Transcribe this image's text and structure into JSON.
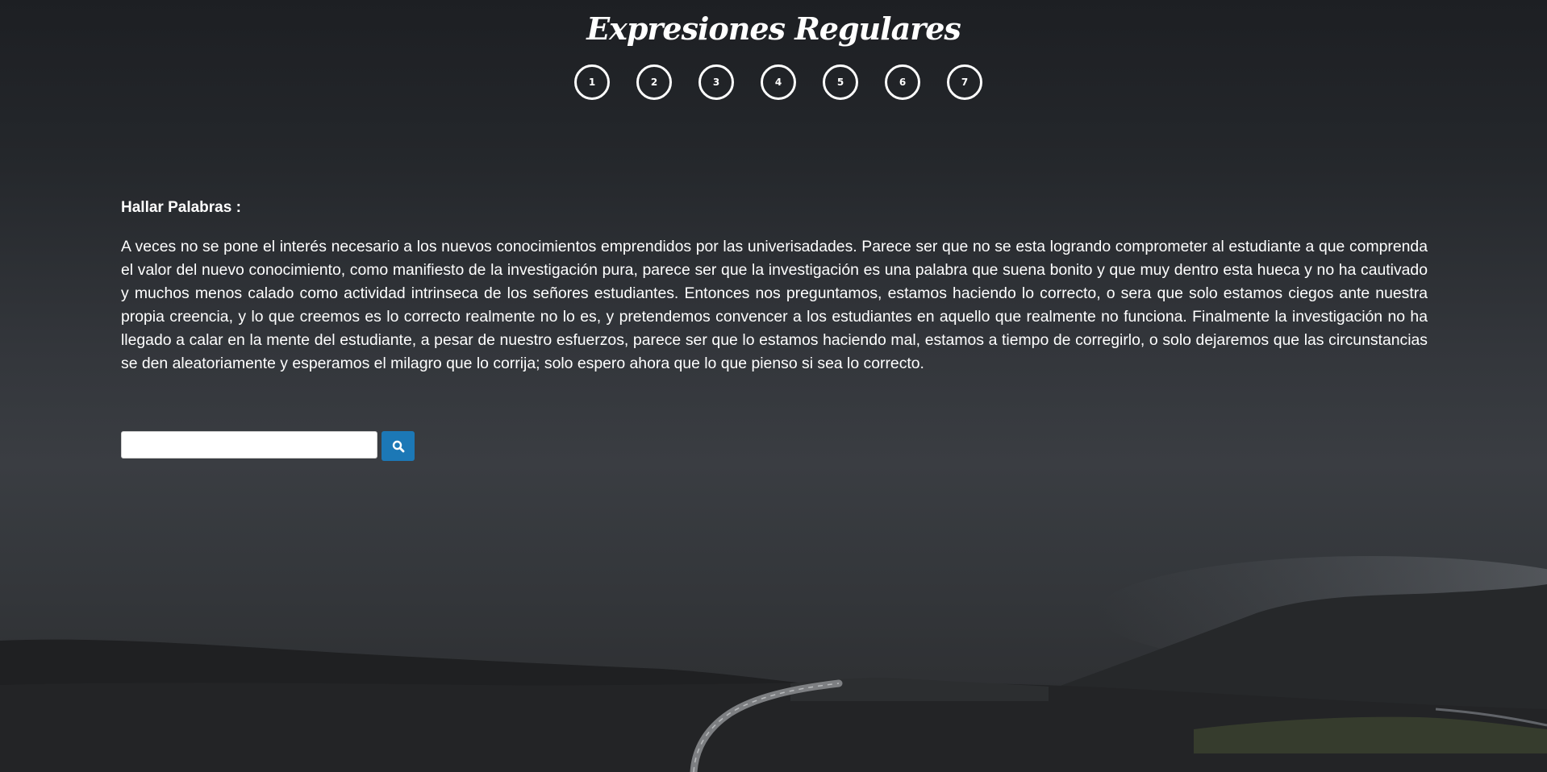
{
  "header": {
    "title": "Expresiones Regulares"
  },
  "pager": {
    "pages": [
      "1",
      "2",
      "3",
      "4",
      "5",
      "6",
      "7"
    ]
  },
  "main": {
    "section_title": "Hallar Palabras :",
    "paragraph": "A veces no se pone el interés necesario a los nuevos conocimientos emprendidos por las univerisadades. Parece ser que no se esta logrando comprometer al estudiante a que comprenda el valor del nuevo conocimiento, como manifiesto de la investigación pura, parece ser que la investigación es una palabra que suena bonito y que muy dentro esta hueca y no ha cautivado y muchos menos calado como actividad intrinseca de los señores estudiantes. Entonces nos preguntamos, estamos haciendo lo correcto, o sera que solo estamos ciegos ante nuestra propia creencia, y lo que creemos es lo correcto realmente no lo es, y pretendemos convencer a los estudiantes en aquello que realmente no funciona. Finalmente la investigación no ha llegado a calar en la mente del estudiante, a pesar de nuestro esfuerzos, parece ser que lo estamos haciendo mal, estamos a tiempo de corregirlo, o solo dejaremos que las circunstancias se den aleatoriamente y esperamos el milagro que lo corrija; solo espero ahora que lo que pienso si sea lo correcto."
  },
  "search": {
    "value": "",
    "placeholder": "",
    "button_icon": "search-icon"
  },
  "colors": {
    "accent": "#1c78b6",
    "text": "#ffffff",
    "background_top": "#1d1f23",
    "background_mid": "#3a3d42"
  }
}
